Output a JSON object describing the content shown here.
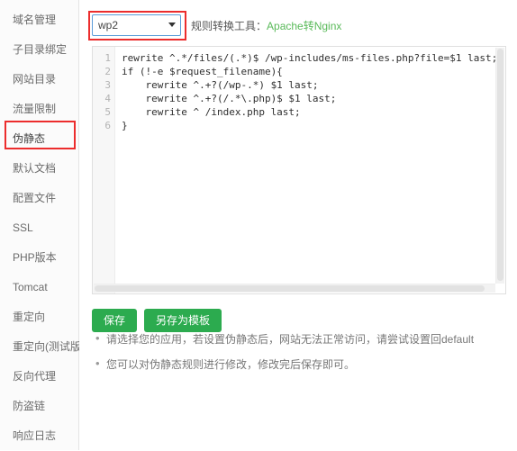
{
  "sidebar": {
    "items": [
      {
        "label": "域名管理",
        "active": false
      },
      {
        "label": "子目录绑定",
        "active": false
      },
      {
        "label": "网站目录",
        "active": false
      },
      {
        "label": "流量限制",
        "active": false
      },
      {
        "label": "伪静态",
        "active": true
      },
      {
        "label": "默认文档",
        "active": false
      },
      {
        "label": "配置文件",
        "active": false
      },
      {
        "label": "SSL",
        "active": false
      },
      {
        "label": "PHP版本",
        "active": false
      },
      {
        "label": "Tomcat",
        "active": false
      },
      {
        "label": "重定向",
        "active": false
      },
      {
        "label": "重定向(测试版)",
        "active": false
      },
      {
        "label": "反向代理",
        "active": false
      },
      {
        "label": "防盗链",
        "active": false
      },
      {
        "label": "响应日志",
        "active": false
      }
    ]
  },
  "toolbar": {
    "select_value": "wp2",
    "select_options": [
      "wp2"
    ],
    "converter_label": "规则转换工具：",
    "converter_link": "Apache转Nginx",
    "link_color": "#5aba5a"
  },
  "editor": {
    "line_numbers": [
      "1",
      "2",
      "3",
      "4",
      "5",
      "6"
    ],
    "lines": [
      "rewrite ^.*/files/(.*)$ /wp-includes/ms-files.php?file=$1 last;",
      "if (!-e $request_filename){",
      "    rewrite ^.+?(/wp-.*) $1 last;",
      "    rewrite ^.+?(/.*\\.php)$ $1 last;",
      "    rewrite ^ /index.php last;",
      "}"
    ]
  },
  "buttons": {
    "save_label": "保存",
    "save_as_template_label": "另存为模板",
    "color": "#2cab4f"
  },
  "notes": {
    "items": [
      "请选择您的应用，若设置伪静态后，网站无法正常访问，请尝试设置回default",
      "您可以对伪静态规则进行修改，修改完后保存即可。"
    ]
  },
  "annotations": {
    "highlight_color": "#ec2d2d"
  }
}
